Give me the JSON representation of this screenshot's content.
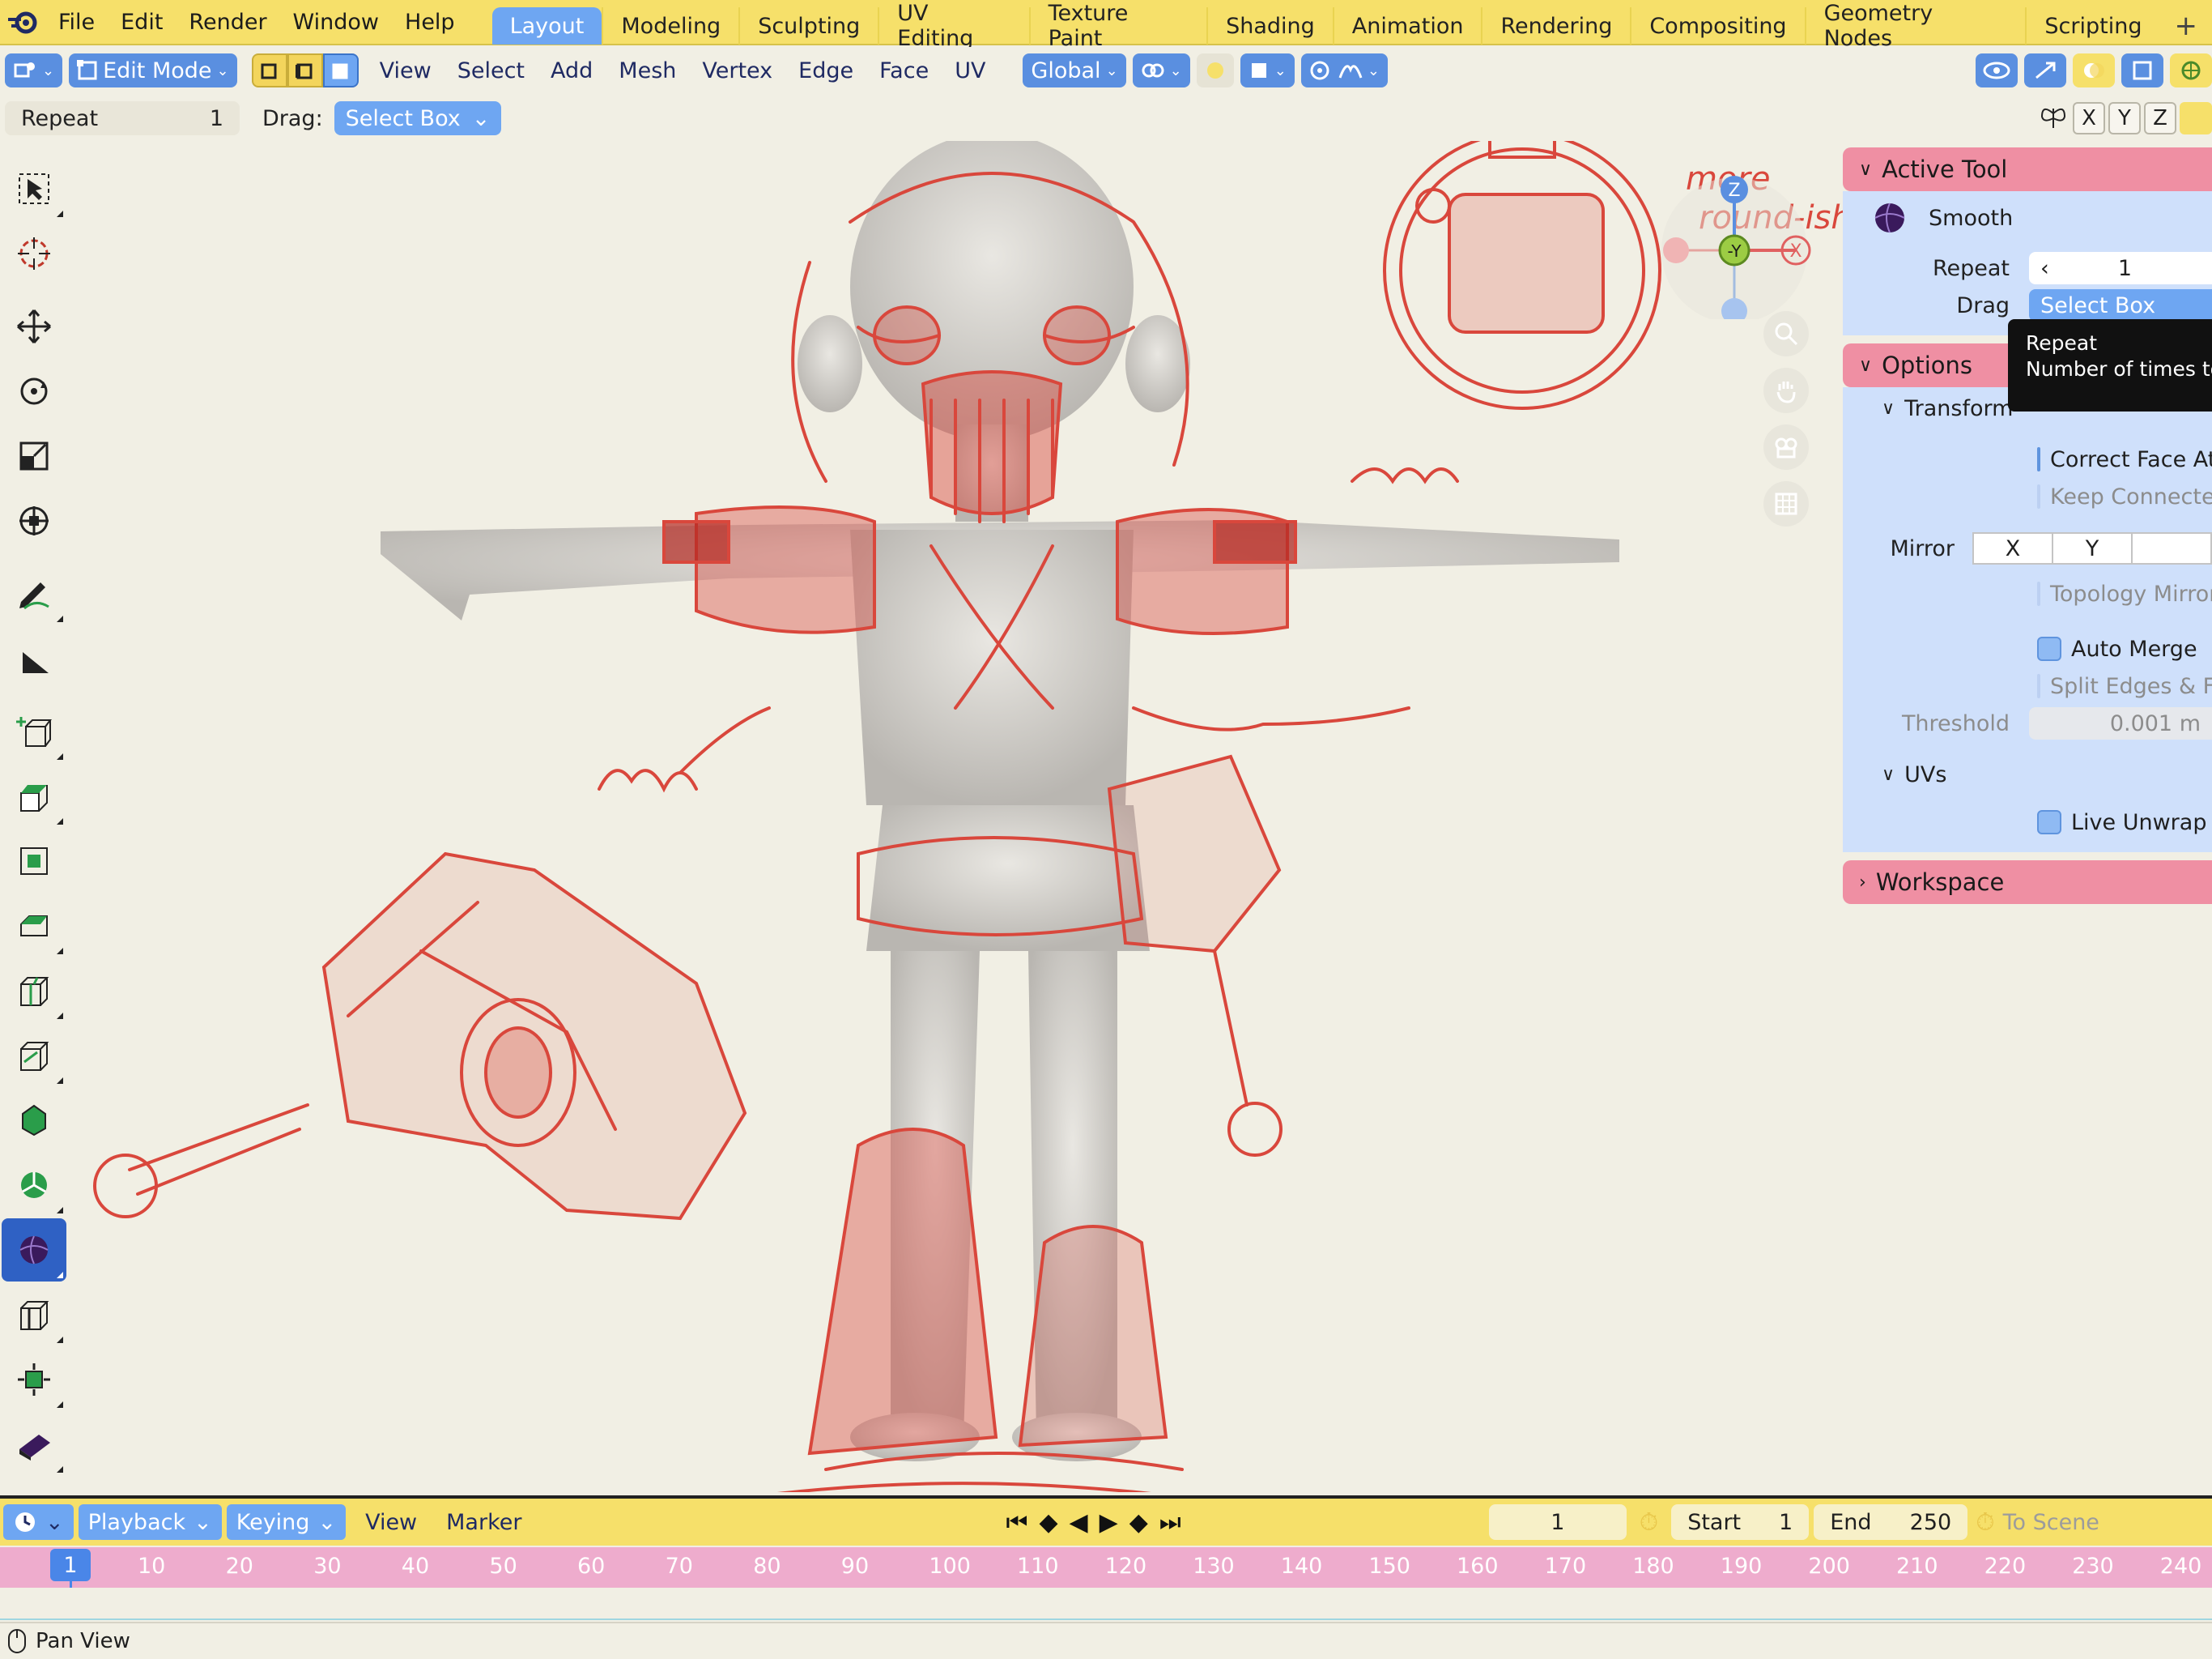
{
  "menu": [
    "File",
    "Edit",
    "Render",
    "Window",
    "Help"
  ],
  "workspaces": [
    "Layout",
    "Modeling",
    "Sculpting",
    "UV Editing",
    "Texture Paint",
    "Shading",
    "Animation",
    "Rendering",
    "Compositing",
    "Geometry Nodes",
    "Scripting"
  ],
  "workspace_add": "+",
  "header": {
    "mode": "Edit Mode",
    "menus": [
      "View",
      "Select",
      "Add",
      "Mesh",
      "Vertex",
      "Edge",
      "Face",
      "UV"
    ],
    "orientation": "Global"
  },
  "toolrow": {
    "repeat_label": "Repeat",
    "repeat_value": "1",
    "drag_label": "Drag:",
    "drag_value": "Select Box",
    "axes": [
      "X",
      "Y",
      "Z"
    ]
  },
  "gizmo": {
    "z": "Z",
    "y": "-Y",
    "x": "X"
  },
  "sidebar": {
    "active_tool_title": "Active Tool",
    "tool_name": "Smooth",
    "repeat_label": "Repeat",
    "repeat_value": "1",
    "drag_label": "Drag",
    "drag_value": "Select Box",
    "options_title": "Options",
    "transform_title": "Transform",
    "correct_face": "Correct Face Attributes",
    "keep_connected": "Keep Connected",
    "mirror_label": "Mirror",
    "mirror_x": "X",
    "mirror_y": "Y",
    "topology_mirror": "Topology Mirror",
    "auto_merge": "Auto Merge",
    "split_edges": "Split Edges & Faces",
    "threshold_label": "Threshold",
    "threshold_value": "0.001 m",
    "uvs_title": "UVs",
    "live_unwrap": "Live Unwrap",
    "workspace_title": "Workspace"
  },
  "tooltip": {
    "title": "Repeat",
    "text": "Number of times to smooth the mesh"
  },
  "annotation": "more round-ish",
  "timeline": {
    "playback": "Playback",
    "keying": "Keying",
    "view": "View",
    "marker": "Marker",
    "current_frame": "1",
    "start_label": "Start",
    "start_value": "1",
    "end_label": "End",
    "end_value": "250",
    "scene_label": "To Scene",
    "cursor_frame": "1",
    "ticks": [
      "10",
      "20",
      "30",
      "40",
      "50",
      "60",
      "70",
      "80",
      "90",
      "100",
      "110",
      "120",
      "130",
      "140",
      "150",
      "160",
      "170",
      "180",
      "190",
      "200",
      "210",
      "220",
      "230",
      "240"
    ]
  },
  "status": {
    "hint": "Pan View"
  },
  "colors": {
    "accent": "#6ea6f2",
    "menubar": "#f6e06a",
    "panel_header": "#ef8fa3",
    "panel_body": "#cfe0fb",
    "ruler": "#eeaccd",
    "sketch": "#d9473c"
  }
}
